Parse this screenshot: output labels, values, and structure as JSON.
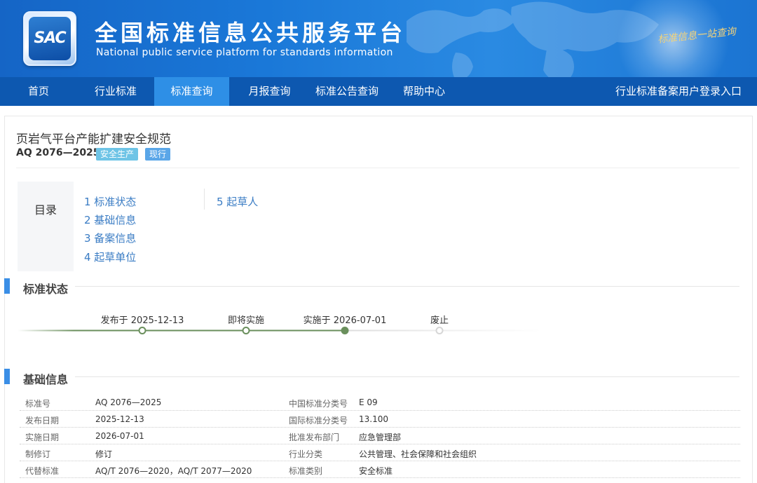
{
  "header": {
    "logo_text": "SAC",
    "site_title": "全国标准信息公共服务平台",
    "site_subtitle": "National public service platform  for standards information",
    "slogan": "标准信息一站查询"
  },
  "nav": {
    "items": [
      {
        "label": "首页",
        "active": false
      },
      {
        "label": "行业标准",
        "active": false
      },
      {
        "label": "标准查询",
        "active": true
      },
      {
        "label": "月报查询",
        "active": false
      },
      {
        "label": "标准公告查询",
        "active": false
      },
      {
        "label": "帮助中心",
        "active": false
      }
    ],
    "login_link": "行业标准备案用户登录入口"
  },
  "standard": {
    "title": "页岩气平台产能扩建安全规范",
    "code": "AQ 2076—2025",
    "category_tag": "安全生产",
    "status_tag": "现行"
  },
  "toc": {
    "label": "目录",
    "items": [
      "1  标准状态",
      "2  基础信息",
      "3  备案信息",
      "4  起草单位",
      "5  起草人"
    ]
  },
  "status_section": {
    "title": "标准状态",
    "timeline": [
      {
        "label": "发布于 2025-12-13",
        "state": "done"
      },
      {
        "label": "即将实施",
        "state": "done"
      },
      {
        "label": "实施于 2026-07-01",
        "state": "current"
      },
      {
        "label": "废止",
        "state": "future"
      }
    ]
  },
  "basic_section": {
    "title": "基础信息",
    "rows": [
      {
        "k1": "标准号",
        "v1": "AQ 2076—2025",
        "k2": "中国标准分类号",
        "v2": "E 09"
      },
      {
        "k1": "发布日期",
        "v1": "2025-12-13",
        "k2": "国际标准分类号",
        "v2": "13.100"
      },
      {
        "k1": "实施日期",
        "v1": "2026-07-01",
        "k2": "批准发布部门",
        "v2": "应急管理部"
      },
      {
        "k1": "制修订",
        "v1": "修订",
        "k2": "行业分类",
        "v2": "公共管理、社会保障和社会组织"
      },
      {
        "k1": "代替标准",
        "v1": "AQ/T 2076—2020，AQ/T 2077—2020",
        "k2": "标准类别",
        "v2": "安全标准"
      }
    ]
  },
  "colors": {
    "banner_blue": "#1a78d8",
    "nav_blue": "#0d58b0",
    "nav_active": "#2e8fe6",
    "timeline_green": "#6a8f5c",
    "link_blue": "#3a7cc4",
    "section_bar": "#3a8ee6"
  }
}
